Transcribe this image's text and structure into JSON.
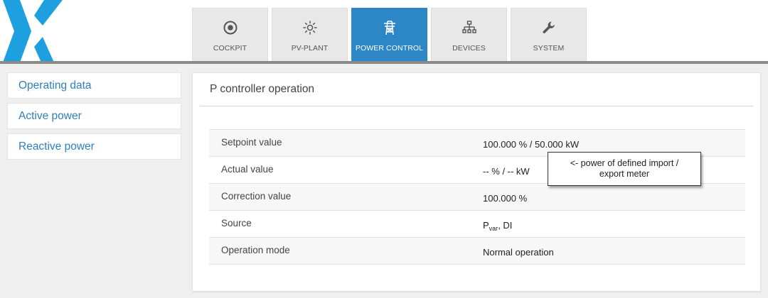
{
  "header": {
    "tabs": [
      {
        "label": "COCKPIT",
        "icon": "target-icon"
      },
      {
        "label": "PV-PLANT",
        "icon": "sun-icon"
      },
      {
        "label": "POWER CONTROL",
        "icon": "transmission-tower-icon"
      },
      {
        "label": "DEVICES",
        "icon": "network-icon"
      },
      {
        "label": "SYSTEM",
        "icon": "wrench-icon"
      }
    ],
    "active_tab": "POWER CONTROL"
  },
  "sidebar": {
    "items": [
      {
        "label": "Operating data"
      },
      {
        "label": "Active power"
      },
      {
        "label": "Reactive power"
      }
    ]
  },
  "panel": {
    "title": "P controller operation",
    "rows": [
      {
        "key": "Setpoint value",
        "value": "100.000 % / 50.000 kW"
      },
      {
        "key": "Actual value",
        "value": "-- % / -- kW"
      },
      {
        "key": "Correction value",
        "value": "100.000 %"
      },
      {
        "key": "Source",
        "value_main": "P",
        "value_sub": "var",
        "value_rest": ", DI"
      },
      {
        "key": "Operation mode",
        "value": "Normal operation"
      }
    ]
  },
  "callout": {
    "line1": "<- power of defined import /",
    "line2": "export meter"
  },
  "colors": {
    "accent": "#2d86c6",
    "logo": "#1ea0e0",
    "link": "#2f7fbd"
  }
}
